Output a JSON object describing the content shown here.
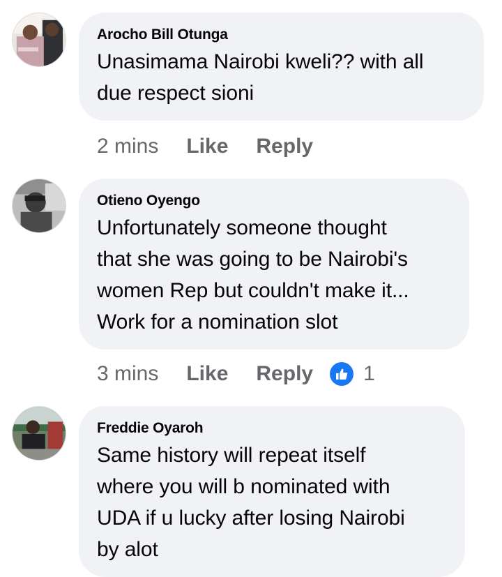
{
  "comments": [
    {
      "author": "Arocho Bill Otunga",
      "lines": [
        "Unasimama Nairobi kweli?? with all",
        "due respect sioni"
      ],
      "time": "2 mins",
      "like_label": "Like",
      "reply_label": "Reply"
    },
    {
      "author": "Otieno Oyengo",
      "lines": [
        "Unfortunately someone thought",
        "that she was going to be Nairobi's",
        "women Rep but couldn't make it...",
        "Work for a nomination slot"
      ],
      "time": "3 mins",
      "like_label": "Like",
      "reply_label": "Reply",
      "reaction_count": "1"
    },
    {
      "author": "Freddie Oyaroh",
      "lines": [
        "Same history will repeat itself",
        "where you will b nominated with",
        "UDA if u lucky after losing Nairobi",
        "by alot"
      ]
    }
  ],
  "icons": {
    "reaction": "like-thumbs-up-icon"
  },
  "colors": {
    "bubble": "#f0f2f5",
    "meta_text": "#65676b",
    "reaction_blue": "#1877f2"
  }
}
